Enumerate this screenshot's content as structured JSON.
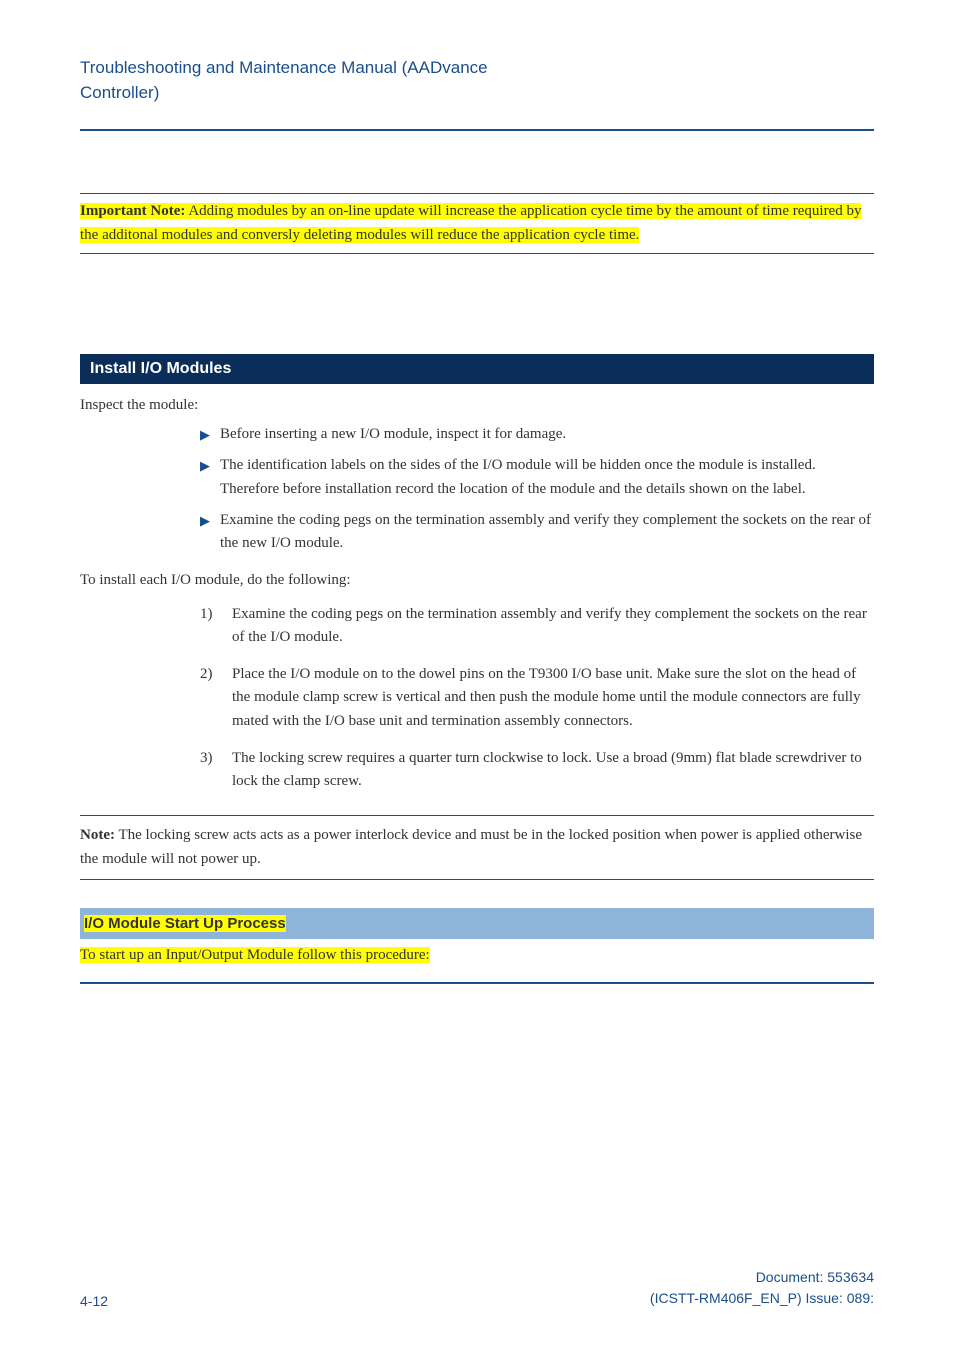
{
  "header": {
    "title_line1": "Troubleshooting and Maintenance Manual (AADvance",
    "title_line2": "Controller)"
  },
  "important_note": {
    "label": "Important Note:",
    "text": " Adding modules by an on-line update will increase the application cycle time by the amount of time required by the additonal modules and conversly deleting modules will reduce the application cycle time."
  },
  "section1": {
    "title": "Install I/O Modules",
    "intro": "Inspect the module:",
    "bullets": [
      "Before inserting a new I/O module, inspect it for damage.",
      "The identification labels on the sides of the I/O module will be hidden once the module is installed. Therefore before installation record the location of the module and the details shown on the label.",
      "Examine the coding pegs on the termination assembly and verify they complement the sockets on the rear of the new I/O module."
    ],
    "intro2": "To install each I/O module, do the following:",
    "steps": [
      "Examine the coding pegs on the termination assembly and verify they complement the sockets on the rear of the I/O module.",
      "Place the I/O module on to the dowel pins on the T9300 I/O base unit. Make sure the slot on the head of the module clamp screw is vertical and then push the module home until the module connectors are fully mated with the I/O base unit and termination assembly connectors.",
      "The locking screw requires a quarter turn clockwise to lock. Use a broad (9mm) flat blade screwdriver to lock the clamp screw."
    ]
  },
  "plain_note": {
    "label": "Note:",
    "text": " The locking screw acts acts as a power interlock device and must be in the locked position when power is applied otherwise the module will not power up."
  },
  "section2": {
    "title": "I/O Module Start Up Process",
    "body": "To start up an Input/Output Module follow this procedure:"
  },
  "footer": {
    "page": "4-12",
    "doc_line1": "Document: 553634",
    "doc_line2": "(ICSTT-RM406F_EN_P) Issue: 089:"
  }
}
